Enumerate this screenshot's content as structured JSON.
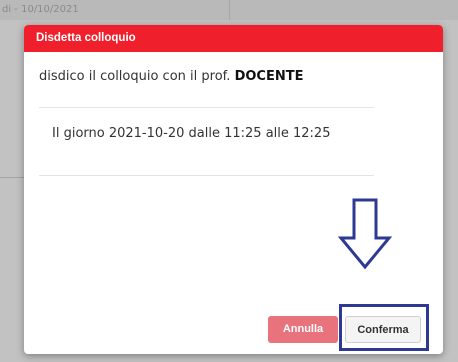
{
  "background": {
    "header_text": "di - 10/10/2021"
  },
  "modal": {
    "title": "Disdetta colloquio",
    "intro_text": "disdico il colloquio con il prof.",
    "teacher": "DOCENTE",
    "schedule": "Il giorno 2021-10-20 dalle 11:25 alle 12:25",
    "cancel_label": "Annulla",
    "confirm_label": "Conferma"
  },
  "colors": {
    "header": "#ef1f2b",
    "cancel_button": "#e9737d",
    "annotation": "#2e3a92"
  },
  "annotation": {
    "icon": "arrow-down-icon"
  }
}
